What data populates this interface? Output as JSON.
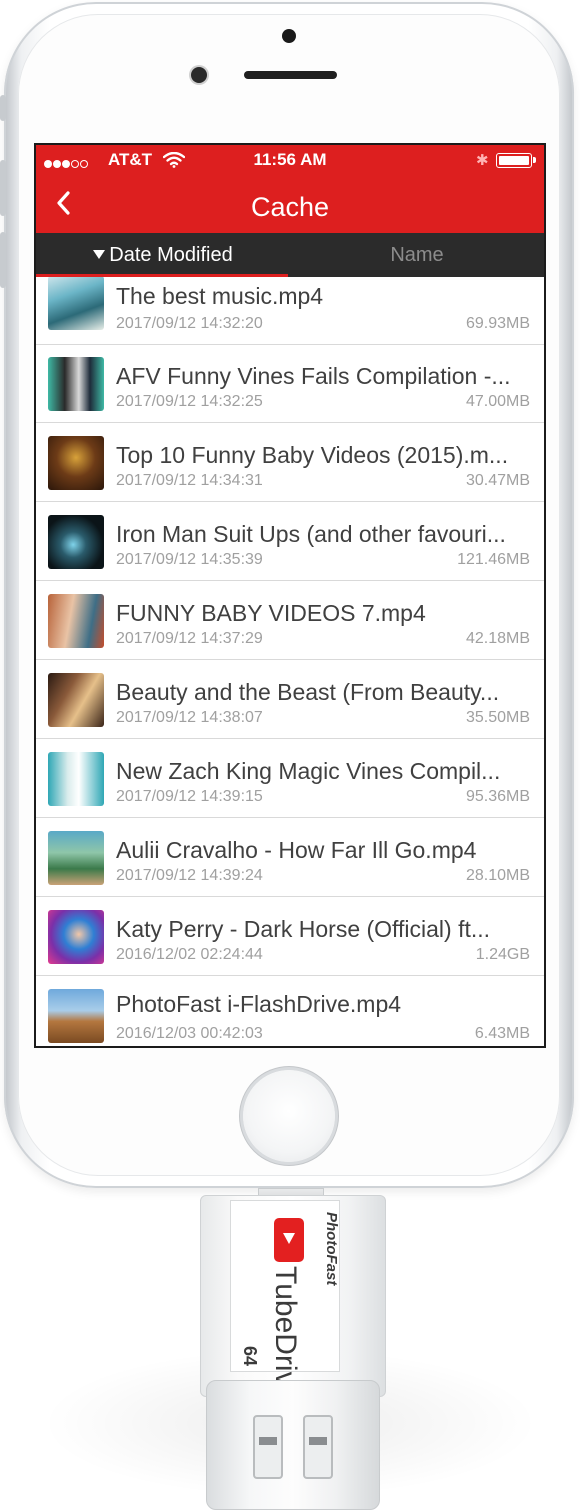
{
  "status_bar": {
    "carrier": "AT&T",
    "time": "11:56 AM",
    "signal_bars_filled": 3,
    "signal_bars_total": 5,
    "battery_level": 1.0
  },
  "nav": {
    "title": "Cache",
    "back_icon": "chevron-left-icon"
  },
  "sort": {
    "date_label": "Date Modified",
    "name_label": "Name",
    "active": "date"
  },
  "files": [
    {
      "name": "The best music.mp4",
      "date": "2017/09/12 14:32:20",
      "size": "69.93MB"
    },
    {
      "name": "AFV Funny Vines Fails Compilation -...",
      "date": "2017/09/12 14:32:25",
      "size": "47.00MB"
    },
    {
      "name": "Top 10 Funny Baby Videos (2015).m...",
      "date": "2017/09/12 14:34:31",
      "size": "30.47MB"
    },
    {
      "name": "Iron Man Suit Ups (and other favouri...",
      "date": "2017/09/12 14:35:39",
      "size": "121.46MB"
    },
    {
      "name": "FUNNY BABY VIDEOS 7.mp4",
      "date": "2017/09/12 14:37:29",
      "size": "42.18MB"
    },
    {
      "name": "Beauty and the Beast (From Beauty...",
      "date": "2017/09/12 14:38:07",
      "size": "35.50MB"
    },
    {
      "name": "New Zach King Magic Vines Compil...",
      "date": "2017/09/12 14:39:15",
      "size": "95.36MB"
    },
    {
      "name": "Aulii Cravalho - How Far Ill Go.mp4",
      "date": "2017/09/12 14:39:24",
      "size": "28.10MB"
    },
    {
      "name": "Katy Perry - Dark Horse (Official) ft...",
      "date": "2016/12/02 02:24:44",
      "size": "1.24GB"
    },
    {
      "name": "PhotoFast i-FlashDrive.mp4",
      "date": "2016/12/03 00:42:03",
      "size": "6.43MB"
    }
  ],
  "device": {
    "brand": "PhotoFast",
    "product": "TubeDrive",
    "capacity": "64"
  },
  "colors": {
    "accent": "#dd1f1f",
    "sort_bar": "#2b2b2b",
    "text_primary": "#404040",
    "text_secondary": "#a0a0a0"
  }
}
